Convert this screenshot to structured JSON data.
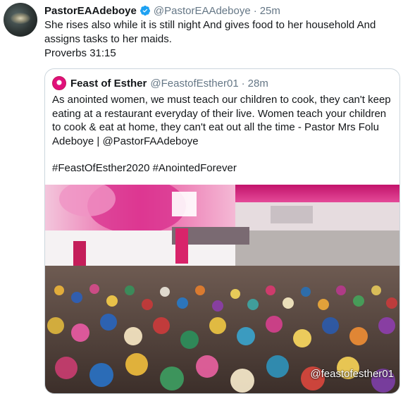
{
  "tweet": {
    "display_name": "PastorEAAdeboye",
    "handle": "@PastorEAAdeboye",
    "separator": "·",
    "time": "25m",
    "text_line1": "She rises also while it is still night And gives food to her household And",
    "text_line2": "assigns tasks to her maids.",
    "text_line3": "Proverbs 31:15",
    "verified_color": "#1da1f2"
  },
  "quoted": {
    "display_name": "Feast of Esther",
    "handle": "@FeastofEsther01",
    "separator": "·",
    "time": "28m",
    "text_line1": "As anointed women, we must teach our children to cook, they can't keep",
    "text_line2": "eating at a restaurant everyday of their live. Women teach your children",
    "text_line3": "to cook & eat at home, they can't eat out all the time - Pastor Mrs Folu",
    "text_line4": "Adeboye | @PastorFAAdeboye",
    "hashtags": "#FeastOfEsther2020 #AnointedForever",
    "image_watermark": "@feastofesther01"
  }
}
